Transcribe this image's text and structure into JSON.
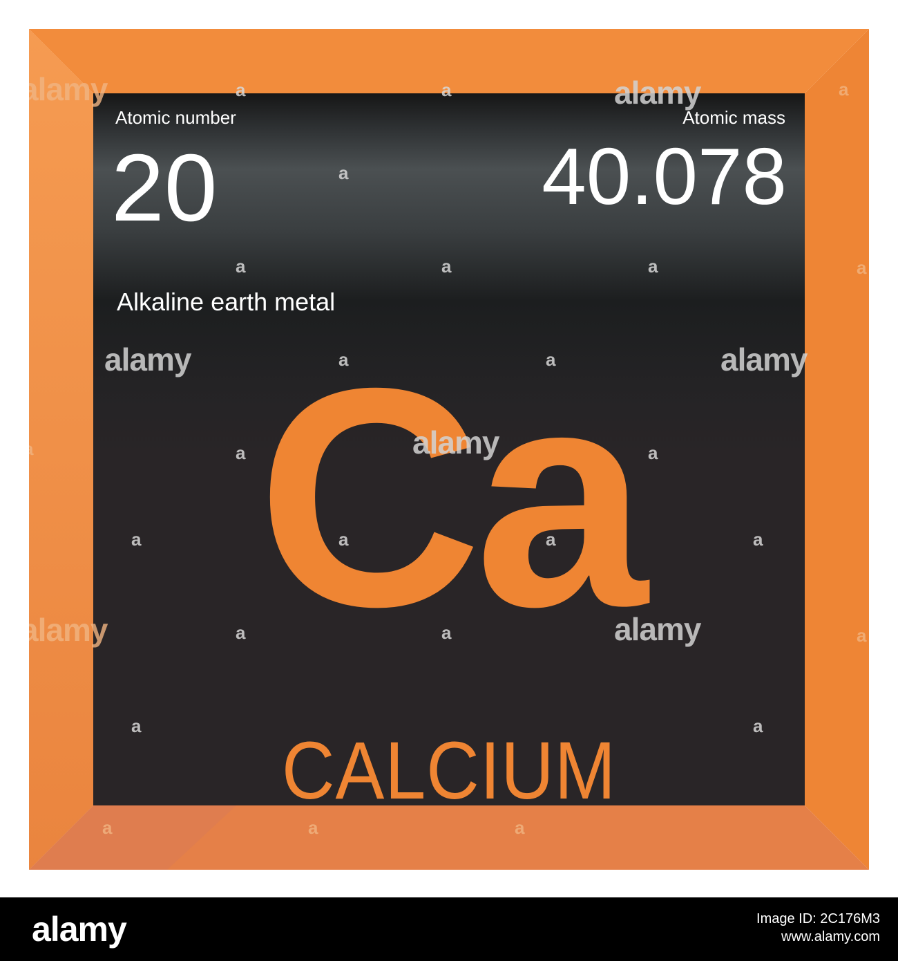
{
  "element": {
    "atomic_number_label": "Atomic number",
    "atomic_number": "20",
    "atomic_mass_label": "Atomic mass",
    "atomic_mass": "40.078",
    "category": "Alkaline earth metal",
    "symbol": "Ca",
    "name": "CALCIUM"
  },
  "watermark": {
    "brand": "alamy",
    "mark": "a"
  },
  "footer": {
    "logo": "alamy",
    "image_id": "Image ID: 2C176M3",
    "site": "www.alamy.com"
  },
  "colors": {
    "accent": "#ef8533",
    "frame": "#f08a3a",
    "tile": "#292527",
    "text": "#ffffff",
    "footer_bg": "#000000"
  },
  "icons": [
    "alamy-logo"
  ]
}
